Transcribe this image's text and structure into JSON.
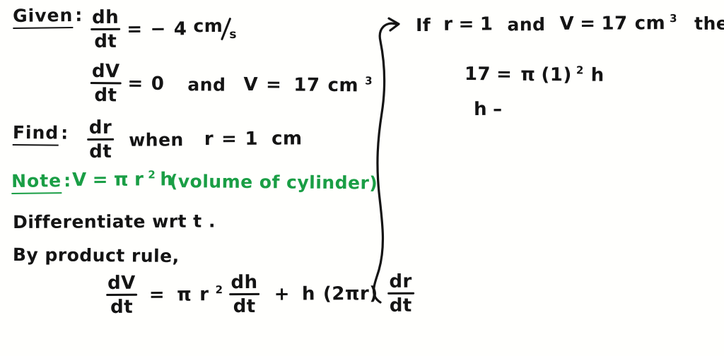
{
  "page": {
    "kind": "handwritten-calculus-worksheet",
    "background_color": "#fffffd",
    "ink_color": "#141414",
    "accent_color": "#1a9e45"
  },
  "left_column": {
    "given": {
      "label": "Given",
      "colon": ":",
      "line1": {
        "fraction_numerator": "dh",
        "fraction_denominator": "dt",
        "equals": "=",
        "minus": "−",
        "value": "4",
        "unit_numerator": "cm",
        "unit_denominator": "s"
      },
      "line2": {
        "fraction_numerator": "dV",
        "fraction_denominator": "dt",
        "equals": "=",
        "value": "0",
        "conjunction": "and",
        "variable": "V",
        "equals2": "=",
        "value2": "17",
        "unit": "cm",
        "unit_exponent": "3"
      }
    },
    "find": {
      "label": "Find",
      "colon": ":",
      "fraction_numerator": "dr",
      "fraction_denominator": "dt",
      "when": "when",
      "variable": "r",
      "equals": "=",
      "value": "1",
      "unit": "cm"
    },
    "note": {
      "label": "Note",
      "colon": ":",
      "variable": "V",
      "equals": "=",
      "pi": "π",
      "radius": "r",
      "radius_exponent": "2",
      "height": "h",
      "parenthetical": "(volume of cylinder)"
    },
    "steps": {
      "line1": "Differentiate wrt t .",
      "line2": "By product rule,"
    },
    "product_rule": {
      "lhs_numerator": "dV",
      "lhs_denominator": "dt",
      "equals": "=",
      "pi": "π",
      "radius": "r",
      "radius_exponent": "2",
      "term1_numerator": "dh",
      "term1_denominator": "dt",
      "plus": "+",
      "height": "h",
      "coefficient": "(2πr)",
      "term2_numerator": "dr",
      "term2_denominator": "dt"
    }
  },
  "right_column": {
    "line1": {
      "if": "If",
      "radius": "r",
      "equals": "=",
      "radius_value": "1",
      "conjunction": "and",
      "volume": "V",
      "equals2": "=",
      "volume_value": "17",
      "unit": "cm",
      "unit_exponent": "3",
      "then": "then"
    },
    "line2": {
      "volume_value": "17",
      "equals": "=",
      "pi": "π",
      "radius_paren": "(1)",
      "exponent": "2",
      "height": "h"
    },
    "line3": {
      "height": "h",
      "dash": "–"
    }
  },
  "annotations": {
    "divider_arrow": "long-curved-arrow-pointing-up-right"
  }
}
